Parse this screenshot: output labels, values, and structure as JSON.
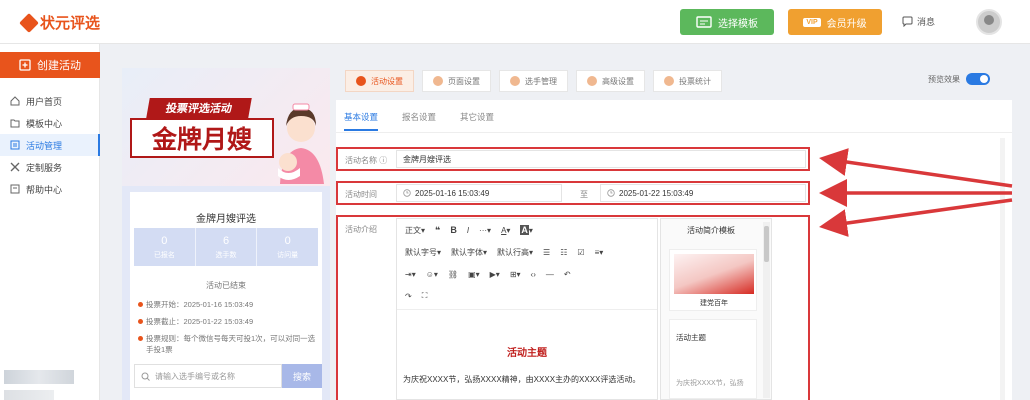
{
  "app": {
    "logo_text": "状元评选"
  },
  "header": {
    "template_btn": "选择模板",
    "vip_tag": "VIP",
    "vip_btn": "会员升级",
    "message": "消息"
  },
  "sidebar": {
    "create_btn": "创建活动",
    "items": [
      {
        "label": "用户首页",
        "icon": "home-icon"
      },
      {
        "label": "模板中心",
        "icon": "folder-icon"
      },
      {
        "label": "活动管理",
        "icon": "list-icon",
        "active": true
      },
      {
        "label": "定制服务",
        "icon": "tools-icon"
      },
      {
        "label": "帮助中心",
        "icon": "help-icon"
      }
    ]
  },
  "preview": {
    "banner_sub": "投票评选活动",
    "banner_main": "金牌月嫂",
    "title": "金牌月嫂评选",
    "stats": [
      {
        "num": "0",
        "label": "已报名"
      },
      {
        "num": "6",
        "label": "选手数"
      },
      {
        "num": "0",
        "label": "访问量"
      }
    ],
    "status": "活动已结束",
    "info": [
      "投票开始：2025-01-16 15:03:49",
      "投票截止：2025-01-22 15:03:49",
      "投票规则：每个微信号每天可投1次，可以对同一选手投1票"
    ],
    "search_placeholder": "请输入选手编号或名称",
    "search_btn": "搜索"
  },
  "tabs": [
    "活动设置",
    "页面设置",
    "选手管理",
    "高级设置",
    "投票统计"
  ],
  "preview_toggle_label": "预览效果",
  "subtabs": [
    "基本设置",
    "报名设置",
    "其它设置"
  ],
  "form": {
    "name_label": "活动名称",
    "name_value": "金牌月嫂评选",
    "time_label": "活动时间",
    "time_start": "2025-01-16 15:03:49",
    "time_sep": "至",
    "time_end": "2025-01-22 15:03:49",
    "intro_label": "活动介绍"
  },
  "editor": {
    "toolbar_row1": [
      "正文",
      "❝",
      "B",
      "I",
      "···",
      "A",
      "A"
    ],
    "font_size": "默认字号",
    "font_family": "默认字体",
    "line_height": "默认行高",
    "content_title": "活动主题",
    "content_text": "为庆祝XXXX节，弘扬XXXX精神，由XXXX主办的XXXX评选活动。"
  },
  "templates": {
    "title": "活动简介模板",
    "tpl1_caption": "建党百年",
    "tpl2_title": "活动主题",
    "tpl2_text": "为庆祝XXXX节，弘扬"
  }
}
